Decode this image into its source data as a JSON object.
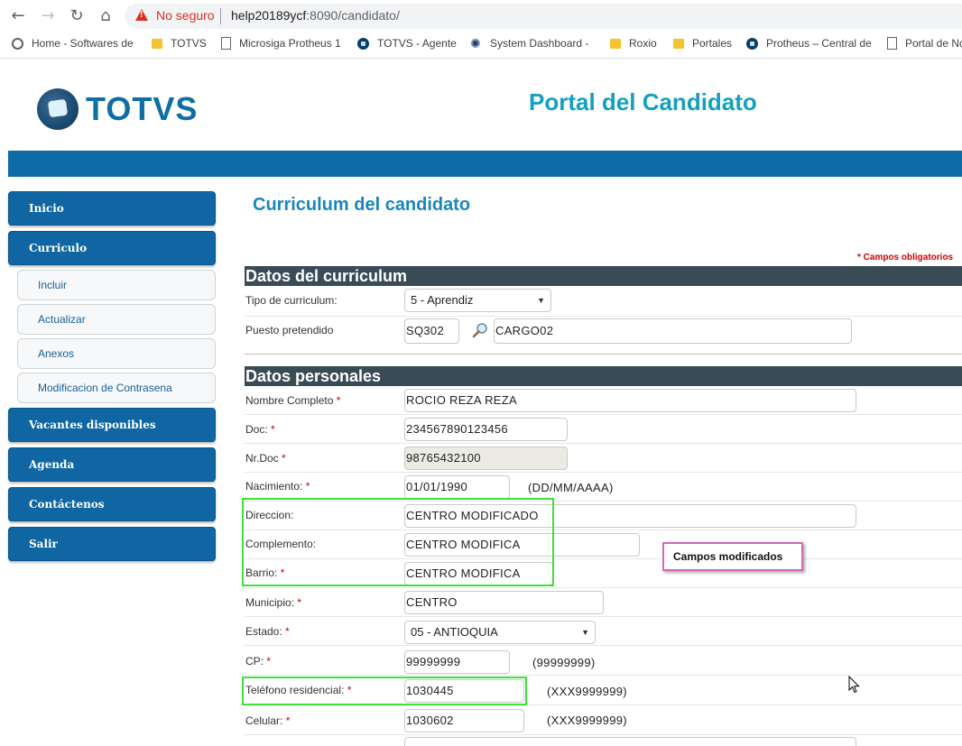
{
  "browser": {
    "security_text": "No seguro",
    "url_host": "help20189ycf",
    "url_path": ":8090/candidato/",
    "bookmarks": [
      "Home - Softwares de",
      "TOTVS",
      "Microsiga Protheus 1",
      "TOTVS - Agente",
      "System Dashboard -",
      "Roxio",
      "Portales",
      "Protheus – Central de",
      "Portal de No"
    ]
  },
  "header": {
    "logo_text": "TOTVS",
    "portal_title": "Portal del Candidato"
  },
  "sidebar": {
    "items": [
      "Inicio",
      "Curriculo",
      "Vacantes disponibles",
      "Agenda",
      "Contáctenos",
      "Salir"
    ],
    "sub_items": [
      "Incluir",
      "Actualizar",
      "Anexos",
      "Modificacion de Contrasena"
    ]
  },
  "main": {
    "title": "Curriculum del candidato",
    "required_note": "* Campos obligatorios",
    "section_cv": "Datos del curriculum",
    "section_personal": "Datos personales",
    "tipo_label": "Tipo de curriculum:",
    "tipo_value": "5 - Aprendiz",
    "puesto_label": "Puesto pretendido",
    "puesto_code": "SQ302",
    "puesto_name": "CARGO02",
    "nombre_label": "Nombre Completo",
    "nombre_value": "ROCIO REZA REZA",
    "doc_label": "Doc:",
    "doc_value": "234567890123456",
    "nrdoc_label": "Nr.Doc",
    "nrdoc_value": "98765432100",
    "nacimiento_label": "Nacimiento:",
    "nacimiento_value": "01/01/1990",
    "nacimiento_hint": "(DD/MM/AAAA)",
    "direccion_label": "Direccion:",
    "direccion_value": "CENTRO MODIFICADO",
    "complemento_label": "Complemento:",
    "complemento_value": "CENTRO MODIFICA",
    "barrio_label": "Barrio:",
    "barrio_value": "CENTRO MODIFICA",
    "municipio_label": "Municipio:",
    "municipio_value": "CENTRO",
    "estado_label": "Estado:",
    "estado_value": "05 - ANTIOQUIA",
    "cp_label": "CP:",
    "cp_value": "99999999",
    "cp_hint": "(99999999)",
    "telefono_label": "Teléfono residencial:",
    "telefono_value": "1030445",
    "telefono_hint": "(XXX9999999)",
    "celular_label": "Celular:",
    "celular_value": "1030602",
    "celular_hint": "(XXX9999999)",
    "req_mark": "*"
  },
  "annotation": {
    "callout_text": "Campos modificados",
    "highlight_color": "#3fe03a",
    "callout_border_color": "#d36ab7"
  }
}
